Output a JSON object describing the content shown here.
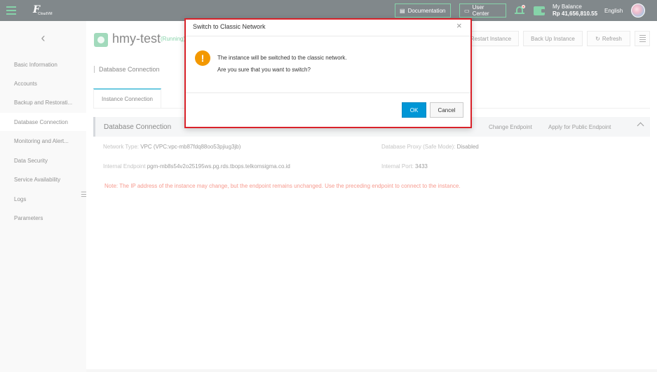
{
  "topbar": {
    "logo_text": "F",
    "logo_sub": "CloudVM",
    "documentation": "Documentation",
    "user_center": "User Center",
    "balance_label": "My Balance",
    "balance_amount": "Rp 41,656,810.55",
    "language": "English",
    "accent_color": "#2fb36b"
  },
  "sidebar": {
    "back_glyph": "‹",
    "items": [
      {
        "label": "Basic Information"
      },
      {
        "label": "Accounts"
      },
      {
        "label": "Backup and Restorati..."
      },
      {
        "label": "Database Connection"
      },
      {
        "label": "Monitoring and Alert..."
      },
      {
        "label": "Data Security"
      },
      {
        "label": "Service Availability"
      },
      {
        "label": "Logs"
      },
      {
        "label": "Parameters"
      }
    ],
    "active_index": 3
  },
  "header": {
    "instance_name": "hmy-test",
    "status": "(Running)",
    "restart": "Restart Instance",
    "backup": "Back Up Instance",
    "refresh": "Refresh"
  },
  "page": {
    "title": "Database Connection",
    "tab": "Instance Connection"
  },
  "panel": {
    "title": "Database Connection",
    "change_endpoint": "Change Endpoint",
    "apply_public": "Apply for Public Endpoint",
    "network_type_label": "Network Type:",
    "network_type_value": "VPC  (VPC:vpc-mb87fdq88oo53pjiug3jb)",
    "proxy_label": "Database Proxy (Safe Mode):",
    "proxy_value": "Disabled",
    "endpoint_label": "Internal Endpoint",
    "endpoint_value": "pgm-mb8s54v2o25195ws.pg.rds.tbops.telkomsigma.co.id",
    "port_label": "Internal Port:",
    "port_value": "3433",
    "note": "Note: The IP address of the instance may change, but the endpoint remains unchanged. Use the preceding endpoint to connect to the instance.",
    "note_color": "#f0503c"
  },
  "dialog": {
    "title": "Switch to Classic Network",
    "close": "×",
    "warn_glyph": "!",
    "line1": "The instance will be switched to the classic network.",
    "line2": "Are you sure that you want to switch?",
    "ok": "OK",
    "cancel": "Cancel",
    "ok_color": "#0096d6",
    "border_color": "#d9222a"
  }
}
